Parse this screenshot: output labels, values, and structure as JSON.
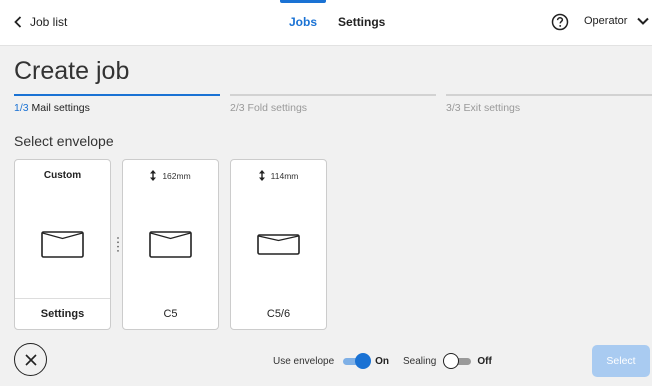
{
  "header": {
    "back_label": "Job list",
    "tabs": [
      {
        "label": "Jobs",
        "active": true
      },
      {
        "label": "Settings",
        "active": false
      }
    ],
    "help_icon": "question-mark-icon",
    "user_label": "Operator"
  },
  "page": {
    "title": "Create job",
    "section_label": "Select envelope"
  },
  "steps": [
    {
      "number": "1/3",
      "label": "Mail settings",
      "active": true
    },
    {
      "number": "2/3",
      "label": "Fold settings",
      "active": false
    },
    {
      "number": "3/3",
      "label": "Exit settings",
      "active": false
    }
  ],
  "envelopes": [
    {
      "header": "Custom",
      "footer": "Settings"
    },
    {
      "height_label": "162mm",
      "name": "C5"
    },
    {
      "height_label": "114mm",
      "name": "C5/6"
    }
  ],
  "footer": {
    "use_envelope_label": "Use envelope",
    "use_envelope_state": "On",
    "sealing_label": "Sealing",
    "sealing_state": "Off",
    "select_label": "Select"
  },
  "colors": {
    "accent": "#1a72d4",
    "disabled_button": "#a9cbf1",
    "background": "#f1f1f1"
  }
}
